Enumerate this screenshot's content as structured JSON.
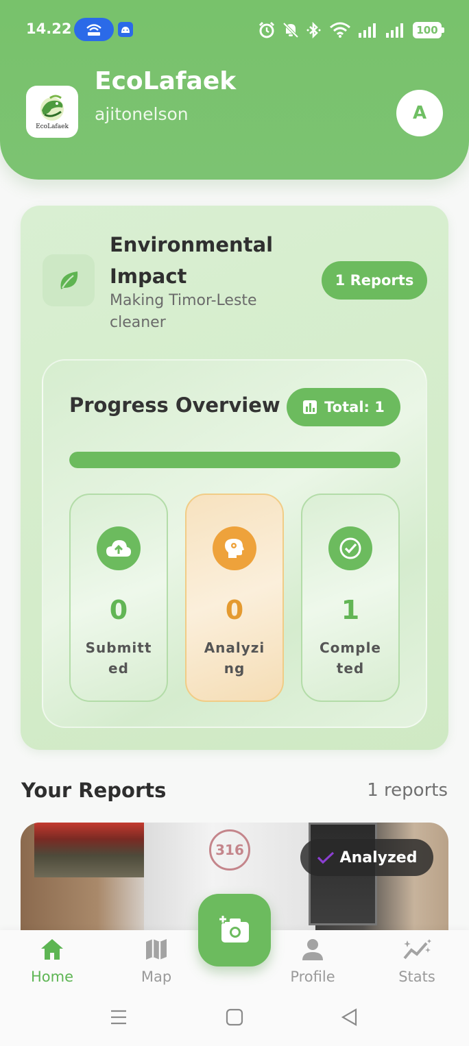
{
  "status_bar": {
    "time": "14.22",
    "battery": "100"
  },
  "header": {
    "app_name": "EcoLafaek",
    "username": "ajitonelson",
    "logo_caption": "EcoLafaek",
    "avatar_letter": "A"
  },
  "impact": {
    "title": "Environmental Impact",
    "subtitle": "Making Timor-Leste cleaner",
    "reports_pill": "1 Reports",
    "icon": "leaf-icon"
  },
  "progress": {
    "title": "Progress Overview",
    "total_label": "Total: 1",
    "fraction": 1.0,
    "stats": [
      {
        "label": "Submitted",
        "value": "0",
        "icon": "cloud-upload-icon"
      },
      {
        "label": "Analyzing",
        "value": "0",
        "icon": "brain-gear-icon"
      },
      {
        "label": "Completed",
        "value": "1",
        "icon": "check-circle-icon"
      }
    ]
  },
  "reports": {
    "heading": "Your Reports",
    "count": "1 reports",
    "items": [
      {
        "status": "Analyzed",
        "jar_text": "316"
      }
    ]
  },
  "bottom_nav": {
    "items": [
      {
        "label": "Home",
        "icon": "home-icon",
        "active": true
      },
      {
        "label": "Map",
        "icon": "map-icon",
        "active": false
      },
      {
        "label": "Profile",
        "icon": "person-icon",
        "active": false
      },
      {
        "label": "Stats",
        "icon": "sparkle-chart-icon",
        "active": false
      }
    ],
    "fab_icon": "add-photo-icon"
  },
  "colors": {
    "primary": "#6cbb5e",
    "header": "#78c26b",
    "accent_orange": "#eea23b"
  }
}
